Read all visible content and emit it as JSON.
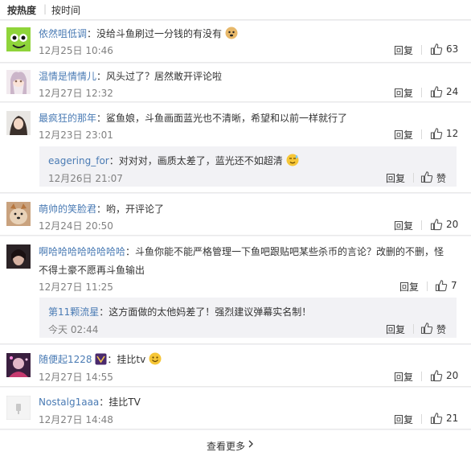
{
  "sort": {
    "hot": "按热度",
    "time": "按时间"
  },
  "comments": [
    {
      "user": "依然咀低调",
      "text": "没给斗鱼刷过一分钱的有没有",
      "time": "12月25日 10:46",
      "reply": "回复",
      "likes": "63"
    },
    {
      "user": "温情是情情儿",
      "text": "风头过了？居然敢开评论啦",
      "time": "12月27日 12:32",
      "reply": "回复",
      "likes": "24"
    },
    {
      "user": "最疯狂的那年",
      "text": "鲨鱼娘，斗鱼画面蓝光也不清晰，希望和以前一样就行了",
      "time": "12月23日 23:01",
      "reply": "回复",
      "likes": "12",
      "sub": {
        "user": "eagering_for",
        "text": "对对对，画质太差了，蓝光还不如超清",
        "time": "12月26日 21:07",
        "reply": "回复",
        "likes": "赞"
      }
    },
    {
      "user": "萌帅的笑脸君",
      "text": "哟，开评论了",
      "time": "12月24日 20:50",
      "reply": "回复",
      "likes": "20"
    },
    {
      "user": "啊哈哈哈哈哈哈哈哈",
      "text": "斗鱼你能不能严格管理一下鱼吧跟贴吧某些杀币的言论？改删的不删，怪",
      "text2": "不得土豪不愿再斗鱼输出",
      "time": "12月27日 11:25",
      "reply": "回复",
      "likes": "7",
      "sub": {
        "user": "第11颗流星",
        "text": "这方面做的太他妈差了！强烈建议弹幕实名制！",
        "time": "今天 02:44",
        "reply": "回复",
        "likes": "赞"
      }
    },
    {
      "user": "随便起1228",
      "text": "挂比tv",
      "time": "12月27日 14:55",
      "reply": "回复",
      "likes": "20"
    },
    {
      "user": "Nostalg1aaa",
      "text": "挂比TV",
      "time": "12月27日 14:48",
      "reply": "回复",
      "likes": "21"
    }
  ],
  "colon": "：",
  "more": "查看更多"
}
